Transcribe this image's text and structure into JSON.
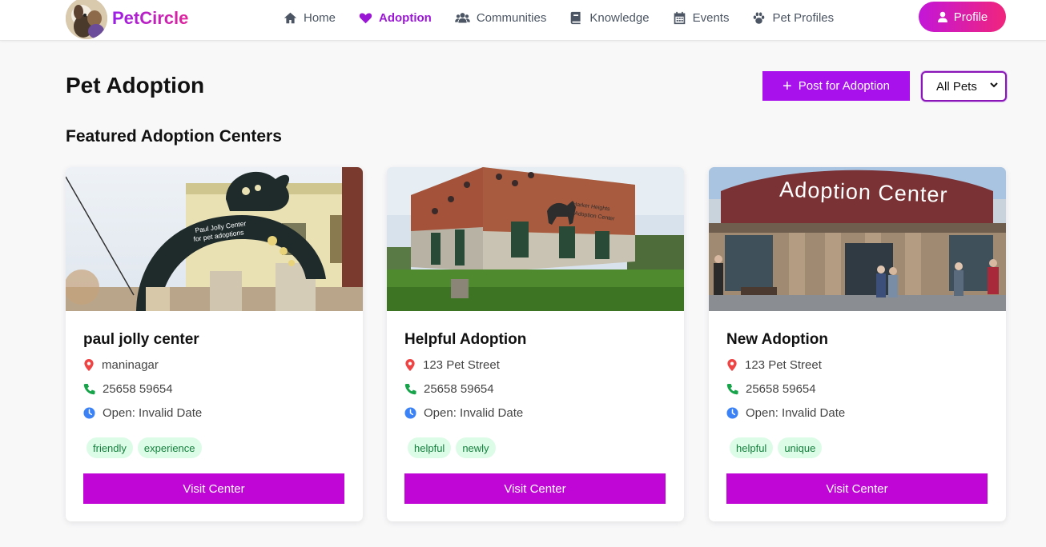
{
  "app": {
    "brand": "PetCircle"
  },
  "nav": {
    "items": [
      {
        "label": "Home",
        "icon": "home-icon"
      },
      {
        "label": "Adoption",
        "icon": "heart-icon"
      },
      {
        "label": "Communities",
        "icon": "users-icon"
      },
      {
        "label": "Knowledge",
        "icon": "book-icon"
      },
      {
        "label": "Events",
        "icon": "calendar-icon"
      },
      {
        "label": "Pet Profiles",
        "icon": "paw-icon"
      }
    ],
    "active": "Adoption",
    "profile_label": "Profile"
  },
  "page": {
    "title": "Pet Adoption",
    "post_button": "Post for Adoption",
    "filter_selected": "All Pets",
    "section_title": "Featured Adoption Centers"
  },
  "centers": [
    {
      "name": "paul jolly center",
      "address": "maninagar",
      "phone": "25658 59654",
      "hours": "Open: Invalid Date",
      "tags": [
        "friendly",
        "experience"
      ],
      "button": "Visit Center",
      "image_text": [
        "Paul Jolly Center",
        "for pet adoptions"
      ]
    },
    {
      "name": "Helpful Adoption",
      "address": "123 Pet Street",
      "phone": "25658 59654",
      "hours": "Open: Invalid Date",
      "tags": [
        "helpful",
        "newly"
      ],
      "button": "Visit Center",
      "image_text": [
        "Harker Heights",
        "Pet Adoption Center"
      ]
    },
    {
      "name": "New Adoption",
      "address": "123 Pet Street",
      "phone": "25658 59654",
      "hours": "Open: Invalid Date",
      "tags": [
        "helpful",
        "unique"
      ],
      "button": "Visit Center",
      "image_text": [
        "Adoption Center"
      ]
    }
  ],
  "colors": {
    "brand_purple": "#a811ec",
    "active_nav": "#9b17d6",
    "visit_button": "#c006d6",
    "tag_bg": "#dcfce7",
    "tag_text": "#15803d",
    "pin": "#ef4444",
    "phone": "#16a34a",
    "clock": "#3b82f6"
  }
}
